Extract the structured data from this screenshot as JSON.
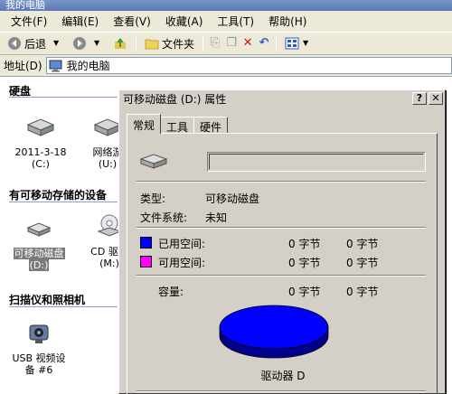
{
  "window": {
    "title": "我的电脑"
  },
  "menu": [
    {
      "label": "文件(F)",
      "name": "menu-file"
    },
    {
      "label": "编辑(E)",
      "name": "menu-edit"
    },
    {
      "label": "查看(V)",
      "name": "menu-view"
    },
    {
      "label": "收藏(A)",
      "name": "menu-favorites"
    },
    {
      "label": "工具(T)",
      "name": "menu-tools"
    },
    {
      "label": "帮助(H)",
      "name": "menu-help"
    }
  ],
  "toolbar": {
    "back_label": "后退",
    "folders_label": "文件夹"
  },
  "address": {
    "label": "地址(D)",
    "value": "我的电脑"
  },
  "sections": {
    "hard_disks": "硬盘",
    "removable": "有可移动存储的设备",
    "scanners": "扫描仪和照相机"
  },
  "items": {
    "disk_c": {
      "line1": "2011-3-18",
      "line2": "(C:)"
    },
    "disk_u": {
      "line1": "网络游",
      "line2": "(U:)"
    },
    "removable_d": {
      "line1": "可移动磁盘",
      "line2": "(D:)"
    },
    "cd_m": {
      "line1": "CD 驱动",
      "line2": "(M:)"
    },
    "usb_camera": {
      "line1": "USB 视频设",
      "line2": "备 #6"
    }
  },
  "dialog": {
    "title": "可移动磁盘 (D:) 属性",
    "help_btn": "?",
    "close_btn": "✕",
    "tabs": [
      "常规",
      "工具",
      "硬件"
    ],
    "name_value": "",
    "type_label": "类型:",
    "type_value": "可移动磁盘",
    "fs_label": "文件系统:",
    "fs_value": "未知",
    "used_label": "已用空间:",
    "free_label": "可用空间:",
    "capacity_label": "容量:",
    "used_bytes": "0 字节",
    "used_size": "0 字节",
    "free_bytes": "0 字节",
    "free_size": "0 字节",
    "cap_bytes": "0 字节",
    "cap_size": "0 字节",
    "drive_label": "驱动器 D",
    "used_color": "#0000ff",
    "free_color": "#ff00ff"
  }
}
